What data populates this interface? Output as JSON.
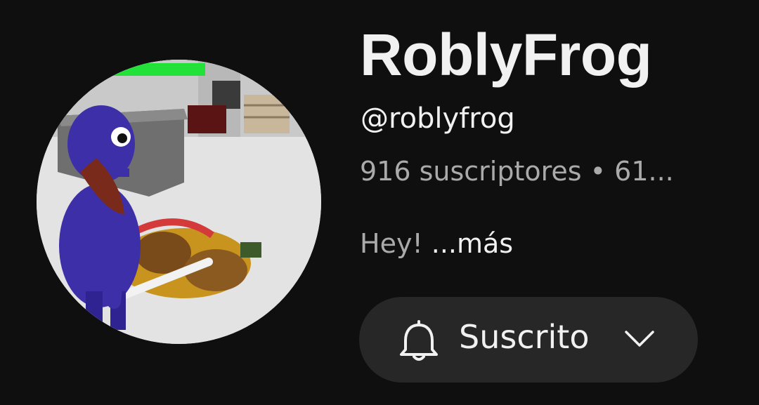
{
  "channel": {
    "name": "RoblyFrog",
    "handle": "@roblyfrog",
    "stats": "916 suscriptores • 61...",
    "description_text": "Hey! ",
    "description_more": "...más",
    "avatar_icon": "channel-avatar-game-scene"
  },
  "subscribe": {
    "label": "Suscrito",
    "bell_icon": "bell-icon",
    "chevron_icon": "chevron-down-icon"
  },
  "colors": {
    "background": "#0f0f0f",
    "primary_text": "#f1f1f1",
    "secondary_text": "#aaaaaa",
    "button_bg": "#272727"
  }
}
